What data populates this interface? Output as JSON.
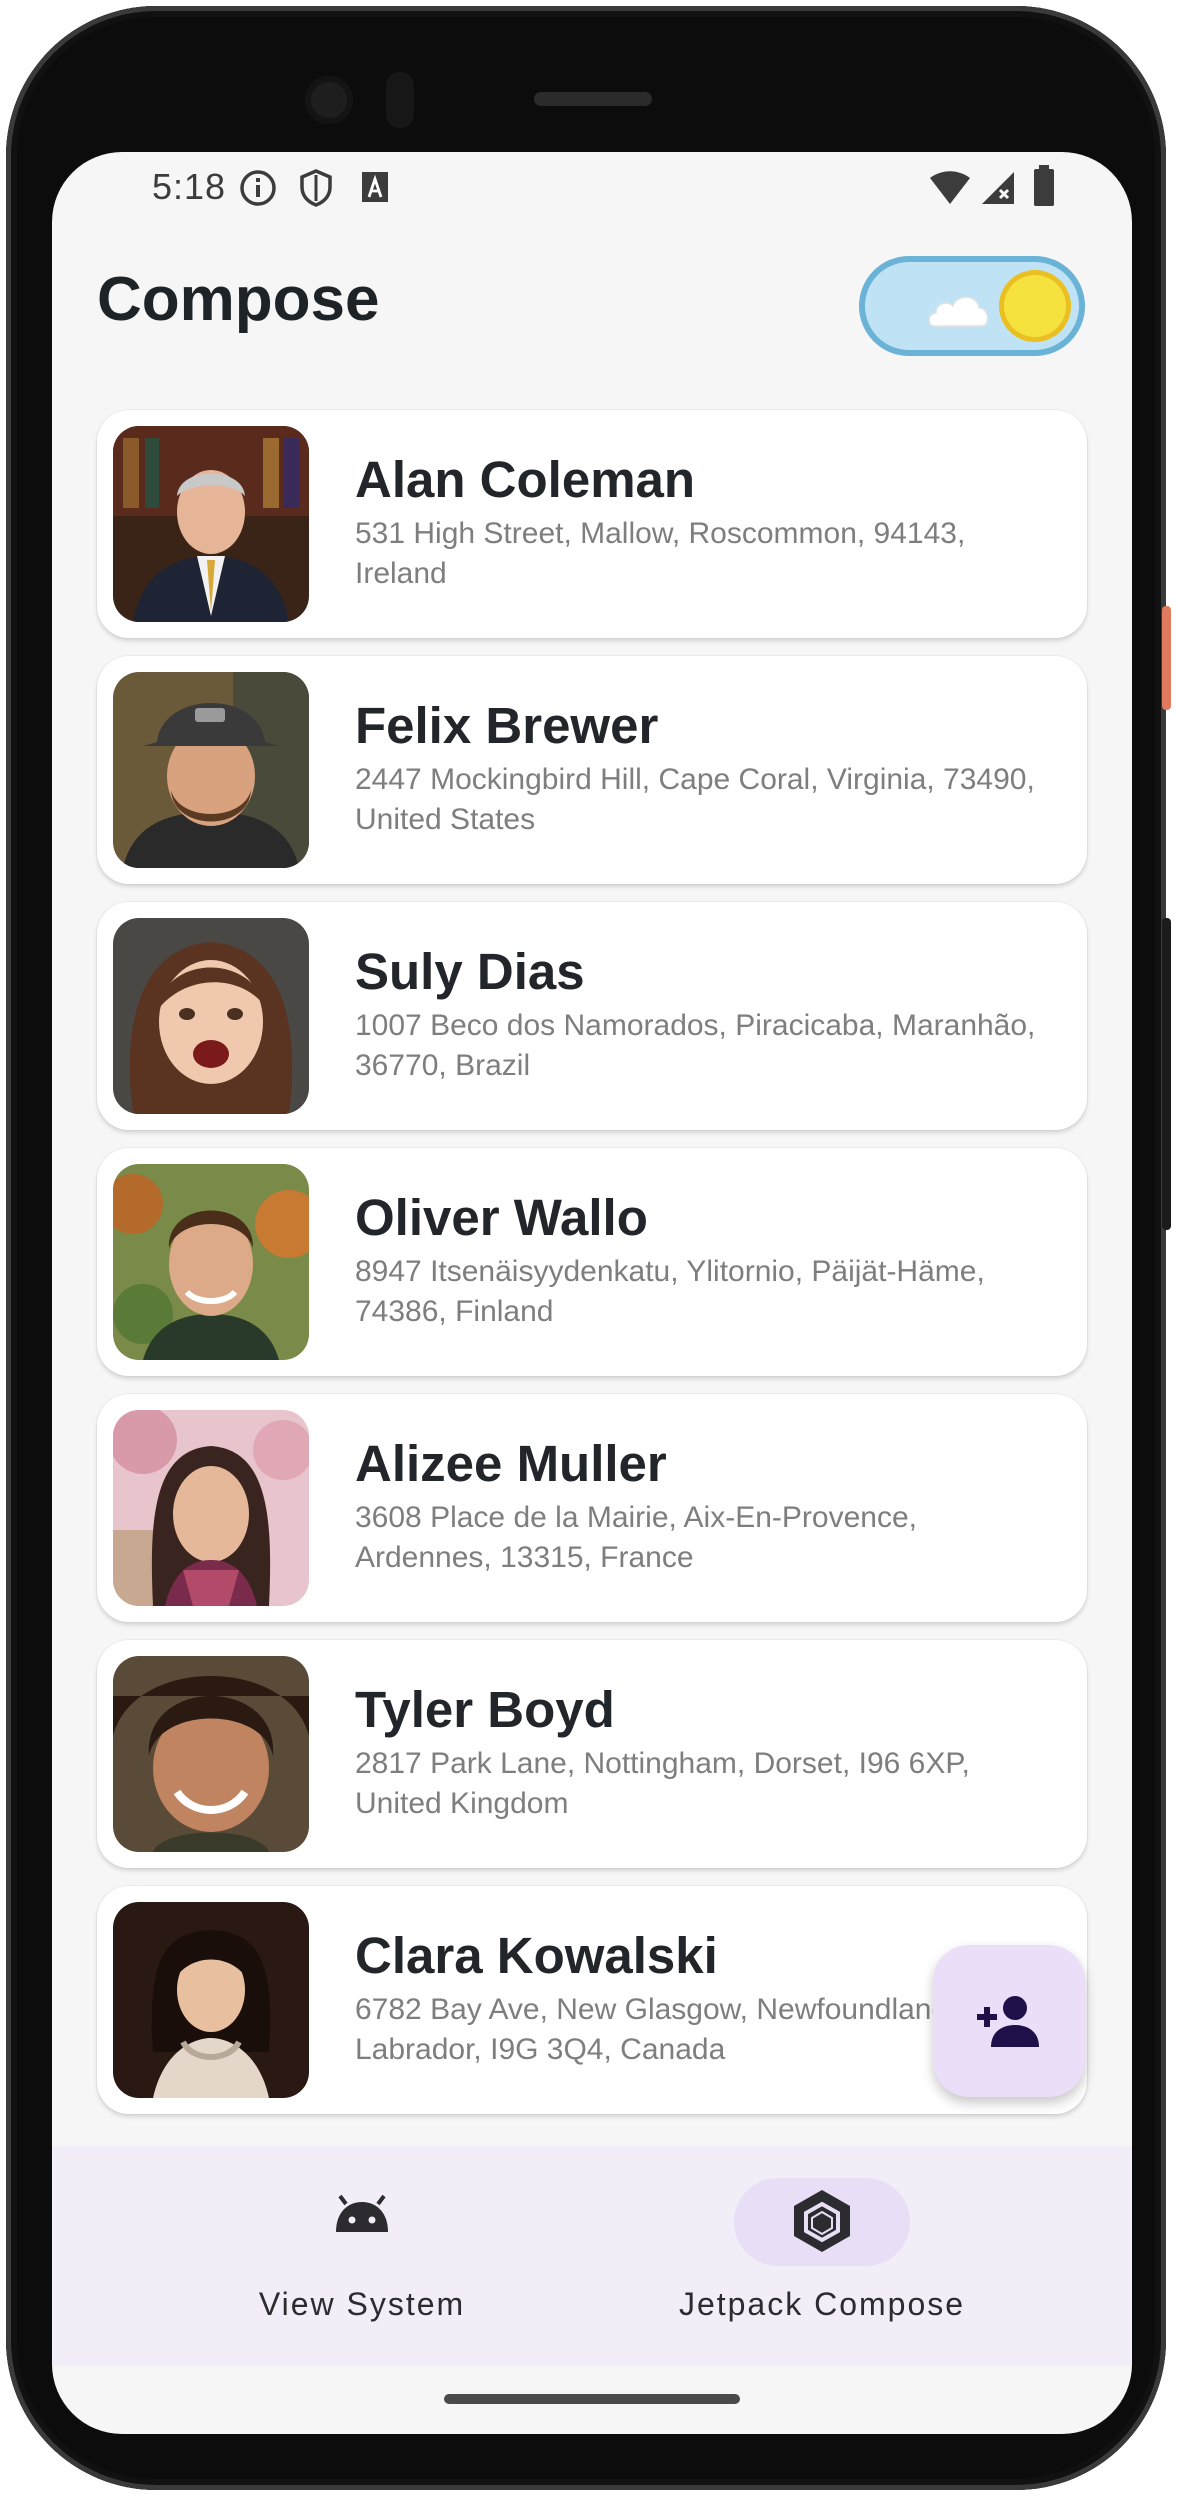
{
  "status_bar": {
    "time": "5:18",
    "icons": [
      "info-icon",
      "shield-icon",
      "keyboard-a-icon",
      "wifi-icon",
      "signal-icon",
      "battery-icon"
    ]
  },
  "header": {
    "title": "Compose",
    "theme_toggle": {
      "state": "light",
      "icons": [
        "cloud-icon",
        "sun-icon"
      ]
    }
  },
  "contacts": [
    {
      "name": "Alan Coleman",
      "address": "531 High Street, Mallow, Roscommon, 94143, Ireland"
    },
    {
      "name": "Felix Brewer",
      "address": "2447 Mockingbird Hill, Cape Coral, Virginia, 73490, United States"
    },
    {
      "name": "Suly Dias",
      "address": "1007 Beco dos Namorados, Piracicaba, Maranhão, 36770, Brazil"
    },
    {
      "name": "Oliver Wallo",
      "address": "8947 Itsenäisyydenkatu, Ylitornio, Päijät-Häme, 74386, Finland"
    },
    {
      "name": "Alizee Muller",
      "address": "3608 Place de la Mairie, Aix-En-Provence, Ardennes, 13315, France"
    },
    {
      "name": "Tyler Boyd",
      "address": "2817 Park Lane, Nottingham, Dorset, I96 6XP, United Kingdom"
    },
    {
      "name": "Clara Kowalski",
      "address": "6782 Bay Ave, New Glasgow, Newfoundland and Labrador, I9G 3Q4, Canada"
    }
  ],
  "fab": {
    "icon": "add-person-icon"
  },
  "bottom_nav": {
    "items": [
      {
        "label": "View System",
        "icon": "android-icon",
        "active": false
      },
      {
        "label": "Jetpack Compose",
        "icon": "compose-hexagon-icon",
        "active": true
      }
    ]
  },
  "colors": {
    "background": "#f6f6f6",
    "card": "#ffffff",
    "fab": "#ebdef8",
    "nav_bar": "#f3edf7",
    "nav_active_pill": "#e8def6",
    "toggle_sky": "#bfe3f5",
    "sun": "#f6e23e"
  }
}
